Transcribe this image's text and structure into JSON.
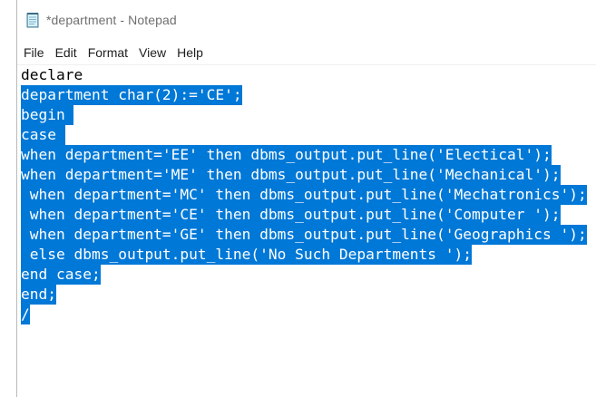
{
  "window": {
    "title": "*department - Notepad"
  },
  "menu": [
    "File",
    "Edit",
    "Format",
    "View",
    "Help"
  ],
  "editor": {
    "lines": [
      {
        "text": "declare",
        "selected": false
      },
      {
        "text": "department char(2):='CE';",
        "selected": true
      },
      {
        "text": "begin ",
        "selected": true
      },
      {
        "text": "case ",
        "selected": true
      },
      {
        "text": "when department='EE' then dbms_output.put_line('Electical');",
        "selected": true
      },
      {
        "text": "when department='ME' then dbms_output.put_line('Mechanical');",
        "selected": true
      },
      {
        "text": " when department='MC' then dbms_output.put_line('Mechatronics');",
        "selected": true
      },
      {
        "text": " when department='CE' then dbms_output.put_line('Computer ');",
        "selected": true
      },
      {
        "text": " when department='GE' then dbms_output.put_line('Geographics ');",
        "selected": true
      },
      {
        "text": " else dbms_output.put_line('No Such Departments ');",
        "selected": true
      },
      {
        "text": "end case;",
        "selected": true
      },
      {
        "text": "end;",
        "selected": true
      },
      {
        "text": "/",
        "selected": true
      }
    ]
  },
  "colors": {
    "selection": "#0078d7",
    "selection_text": "#ffffff"
  },
  "icons": {
    "app": "notepad-icon"
  }
}
